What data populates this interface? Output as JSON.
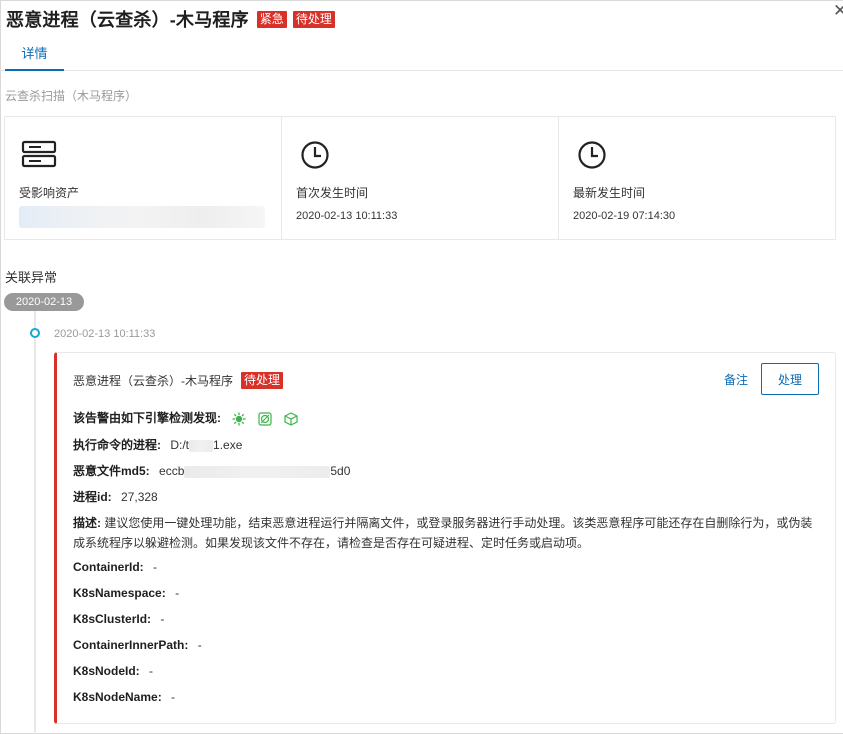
{
  "header": {
    "title": "恶意进程（云查杀）-木马程序",
    "tags": [
      "紧急",
      "待处理"
    ],
    "close_glyph": "✕"
  },
  "tabs": [
    {
      "label": "详情"
    }
  ],
  "subtitle": "云查杀扫描（木马程序）",
  "cards": [
    {
      "label": "受影响资产",
      "value": "",
      "icon": "server-icon"
    },
    {
      "label": "首次发生时间",
      "value": "2020-02-13 10:11:33",
      "icon": "clock-icon"
    },
    {
      "label": "最新发生时间",
      "value": "2020-02-19 07:14:30",
      "icon": "clock-icon"
    }
  ],
  "related": {
    "title": "关联异常",
    "date_pill": "2020-02-13",
    "timestamp": "2020-02-13 10:11:33"
  },
  "event": {
    "title": "恶意进程（云查杀）-木马程序",
    "status_tag": "待处理",
    "note_label": "备注",
    "handle_label": "处理",
    "engine_label": "该告警由如下引擎检测发现:",
    "engine_icons": [
      "virus-icon",
      "scan-icon",
      "sandbox-cube-icon"
    ],
    "cmd_label": "执行命令的进程:",
    "cmd_prefix": "D:/t",
    "cmd_suffix": "1.exe",
    "md5_label": "恶意文件md5:",
    "md5_prefix": "eccb",
    "md5_suffix": "5d0",
    "pid_label": "进程id:",
    "pid_value": "27,328",
    "desc_label": "描述:",
    "desc_text": "建议您使用一键处理功能，结束恶意进程运行并隔离文件，或登录服务器进行手动处理。该类恶意程序可能还存在自删除行为，或伪装成系统程序以躲避检测。如果发现该文件不存在，请检查是否存在可疑进程、定时任务或启动项。",
    "fields": [
      {
        "label": "ContainerId:",
        "value": "-"
      },
      {
        "label": "K8sNamespace:",
        "value": "-"
      },
      {
        "label": "K8sClusterId:",
        "value": "-"
      },
      {
        "label": "ContainerInnerPath:",
        "value": "-"
      },
      {
        "label": "K8sNodeId:",
        "value": "-"
      },
      {
        "label": "K8sNodeName:",
        "value": "-"
      }
    ]
  },
  "colors": {
    "accent": "#0b6bb3",
    "danger": "#d8312a",
    "timeline_dot": "#14a8d1",
    "engine_icon": "#3bb54a"
  }
}
